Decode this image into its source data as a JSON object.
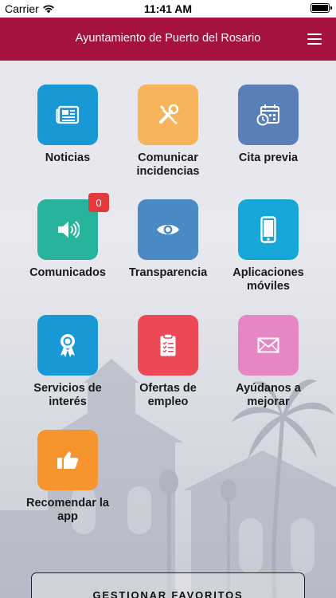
{
  "status_bar": {
    "carrier": "Carrier",
    "time": "11:41 AM"
  },
  "header": {
    "title": "Ayuntamiento de Puerto del Rosario"
  },
  "tiles": [
    {
      "label": "Noticias",
      "color": "#1899d5",
      "icon": "newspaper-icon"
    },
    {
      "label": "Comunicar incidencias",
      "color": "#f8b45a",
      "icon": "tools-icon"
    },
    {
      "label": "Cita previa",
      "color": "#5b7fb9",
      "icon": "calendar-clock-icon"
    },
    {
      "label": "Comunicados",
      "color": "#27b39c",
      "icon": "speaker-icon",
      "badge": "0"
    },
    {
      "label": "Transparencia",
      "color": "#4a8ac4",
      "icon": "eye-icon"
    },
    {
      "label": "Aplicaciones móviles",
      "color": "#17a6d8",
      "icon": "phone-icon"
    },
    {
      "label": "Servicios de interés",
      "color": "#1899d5",
      "icon": "award-icon"
    },
    {
      "label": "Ofertas de empleo",
      "color": "#ec4856",
      "icon": "clipboard-icon"
    },
    {
      "label": "Ayúdanos a mejorar",
      "color": "#e587c4",
      "icon": "envelope-icon"
    },
    {
      "label": "Recomendar la app",
      "color": "#f6952d",
      "icon": "thumbs-up-icon"
    }
  ],
  "favorites_button": {
    "label": "GESTIONAR FAVORITOS"
  }
}
